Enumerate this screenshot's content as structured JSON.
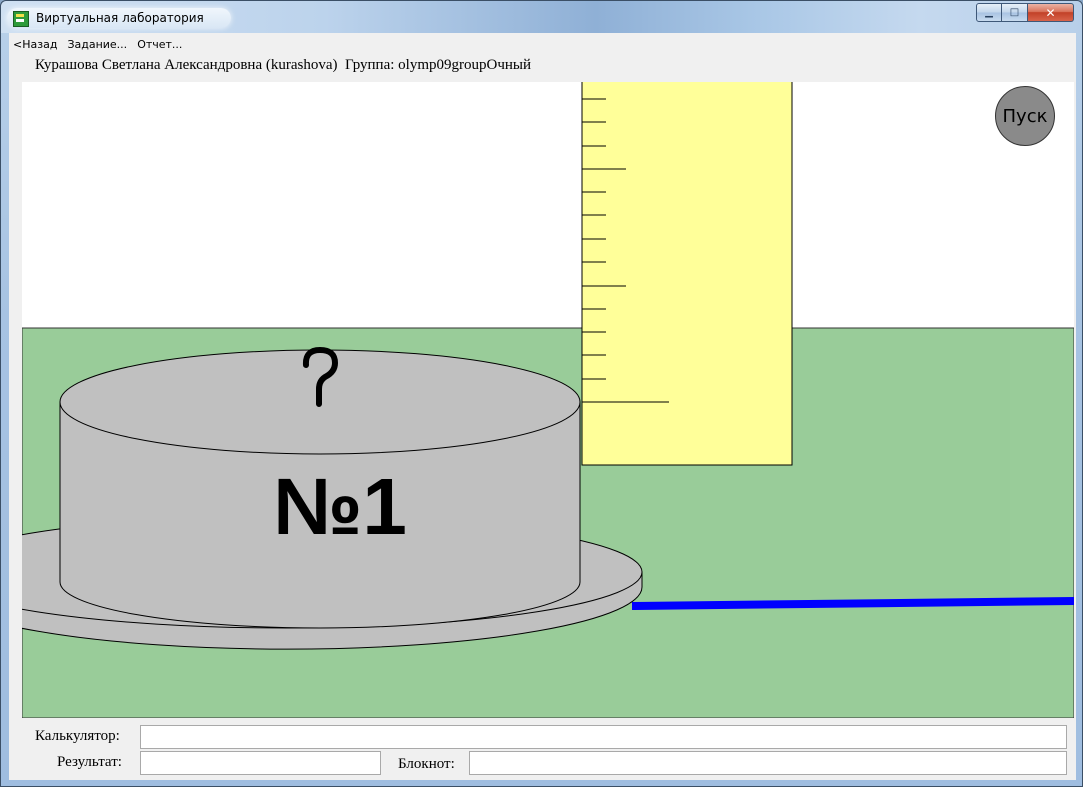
{
  "window": {
    "title": "Виртуальная лаборатория",
    "controls": {
      "minimize": "▁",
      "maximize": "□",
      "close": "✕"
    }
  },
  "menu": {
    "items": [
      "<Назад",
      "Задание...",
      "Отчет..."
    ]
  },
  "user": {
    "info": "Курашова Светлана Александровна (kurashova)  Группа: olymp09groupОчный"
  },
  "scene": {
    "start_label": "Пуск",
    "cylinder_label": "№1",
    "hook_glyph": "?",
    "colors": {
      "sky": "#ffffff",
      "floor": "#99cc99",
      "cylinder": "#c0c0c0",
      "ruler": "#ffff99",
      "wire": "#0000ff",
      "start_button": "#8a8a8a"
    }
  },
  "bottom": {
    "calculator_label": "Калькулятор:",
    "calculator_value": "",
    "result_label": "Результат:",
    "result_value": "",
    "notepad_label": "Блокнот:",
    "notepad_value": ""
  }
}
